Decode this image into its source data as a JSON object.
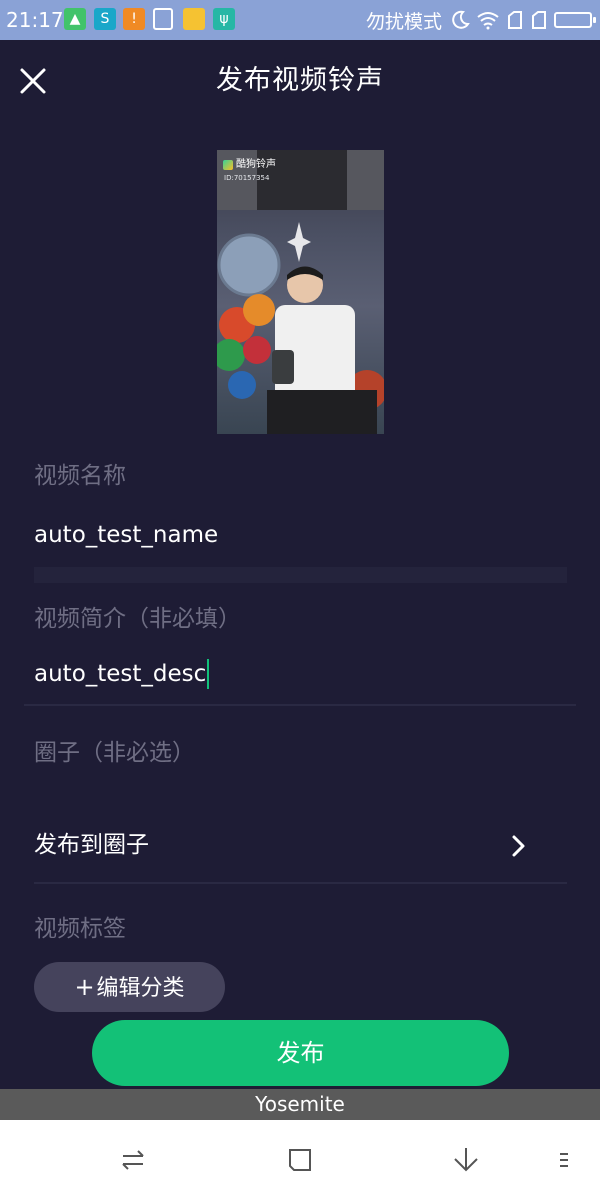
{
  "status_bar": {
    "time": "21:17",
    "dnd_label": "勿扰模式",
    "notification_icons": [
      "android-app-icon",
      "sync-app-icon",
      "warning-icon",
      "cleaner-icon",
      "folder-icon",
      "usb-icon"
    ],
    "background_color": "#8aa2d6"
  },
  "header": {
    "title": "发布视频铃声",
    "close_icon": "close-icon"
  },
  "thumbnail": {
    "logo_text": "酷狗铃声",
    "id_text": "ID:70157354"
  },
  "form": {
    "name_label": "视频名称",
    "name_value": "auto_test_name",
    "desc_label": "视频简介（非必填）",
    "desc_value": "auto_test_desc",
    "circle_label": "圈子（非必选）",
    "circle_row_label": "发布到圈子",
    "tags_label": "视频标签",
    "tag_button_plus": "+",
    "tag_button_label": "编辑分类"
  },
  "publish_button_label": "发布",
  "toast_text": "Yosemite",
  "nav_bar": {
    "icons": [
      "switch-icon",
      "home-square-icon",
      "down-arrow-icon",
      "menu-icon"
    ]
  },
  "colors": {
    "background": "#1e1c35",
    "accent": "#13c177",
    "label": "#6f6e84",
    "chip": "#45435c"
  }
}
